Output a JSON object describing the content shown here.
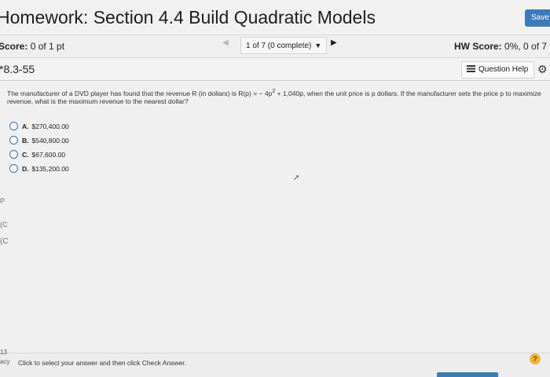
{
  "header": {
    "title": "Homework: Section 4.4 Build Quadratic Models",
    "save_label": "Save"
  },
  "score_bar": {
    "score_label": "Score:",
    "score_value": "0 of 1 pt",
    "nav_prev_icon": "chevron-left-icon",
    "nav_label": "1 of 7 (0 complete)",
    "nav_next_icon": "chevron-right-icon",
    "hw_score_label": "HW Score:",
    "hw_score_value": "0%, 0 of 7 pt"
  },
  "question_bar": {
    "question_id": "*8.3-55",
    "help_label": "Question Help"
  },
  "question": {
    "text_part1": "The manufacturer of a DVD player has found that the revenue R (in dollars) is R(p) = − 4p",
    "exponent": "2",
    "text_part2": " + 1,040p, when the unit price is p dollars. If the manufacturer sets the price p to maximize revenue, what is the maximum revenue to the nearest dollar?",
    "choices": [
      {
        "letter": "A.",
        "value": "$270,400.00"
      },
      {
        "letter": "B.",
        "value": "$540,800.00"
      },
      {
        "letter": "C.",
        "value": "$67,600.00"
      },
      {
        "letter": "D.",
        "value": "$135,200.00"
      }
    ]
  },
  "left_edge": {
    "a": "P",
    "b": "(C",
    "c": "(C",
    "num": "13",
    "acy": "acy"
  },
  "footer": {
    "instruction": "Click to select your answer and then click Check Answer.",
    "help_symbol": "?"
  },
  "colors": {
    "accent": "#3b7bb9",
    "help_circle": "#f0b43b"
  }
}
